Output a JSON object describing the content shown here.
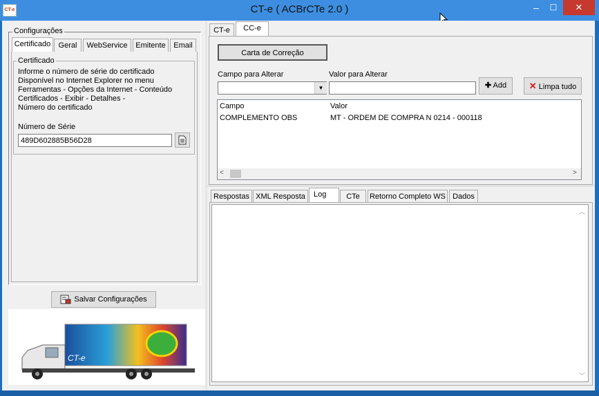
{
  "window": {
    "title": "CT-e  ( ACBrCTe 2.0 )",
    "icon_label": "CT-e",
    "minimize": "‒",
    "maximize": "☐",
    "close": "✕"
  },
  "left": {
    "group_title": "Configurações",
    "tabs": [
      "Certificado",
      "Geral",
      "WebService",
      "Emitente",
      "Email"
    ],
    "cert_group_title": "Certificado",
    "cert_info": [
      "Informe o número de série do certificado",
      "Disponível no Internet Explorer no menu",
      "Ferramentas - Opções da Internet - Conteúdo",
      "Certificados - Exibir - Detalhes -",
      "Número do certificado"
    ],
    "serial_label": "Número de Série",
    "serial_value": "489D602885B56D28",
    "save_button": "Salvar Configurações",
    "banner_text": "CT-e"
  },
  "right": {
    "top_tabs": [
      "CT-e",
      "CC-e"
    ],
    "carta_button": "Carta de Correção",
    "campo_label": "Campo para Alterar",
    "valor_label": "Valor para Alterar",
    "campo_value": "",
    "valor_value": "",
    "add_button": "Add",
    "clear_button": "Limpa tudo",
    "grid": {
      "columns": [
        "Campo",
        "Valor"
      ],
      "rows": [
        [
          "COMPLEMENTO OBS",
          "MT - ORDEM DE COMPRA N 0214 - 000118"
        ]
      ]
    },
    "bottom_tabs": [
      "Respostas",
      "XML Resposta",
      "Log",
      "CTe",
      "Retorno Completo WS",
      "Dados"
    ]
  }
}
